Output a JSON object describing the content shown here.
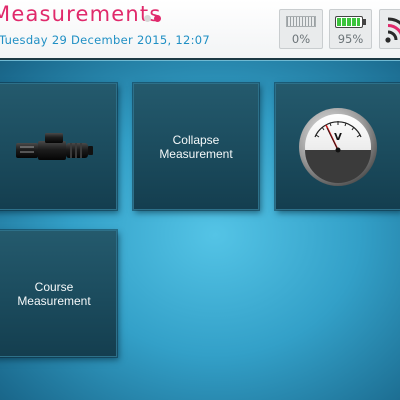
{
  "header": {
    "title": "Measurements",
    "datetime": "Tuesday 29 December 2015, 12:07",
    "page_indicator": {
      "count": 2,
      "active": 2
    },
    "signal": {
      "icon": "signal-strength-icon",
      "value": "0%"
    },
    "battery": {
      "icon": "battery-icon",
      "value": "95%",
      "level": 0.95,
      "color": "#3cc43c"
    },
    "wifi": {
      "icon": "wifi-icon"
    }
  },
  "tiles": [
    {
      "id": "tile-1",
      "icon": "sensor-probe-icon",
      "label": ""
    },
    {
      "id": "tile-2",
      "icon": "",
      "label": "Collapse\nMeasurement"
    },
    {
      "id": "tile-3",
      "icon": "voltmeter-gauge-icon",
      "label": ""
    },
    {
      "id": "tile-4",
      "icon": "",
      "label": "Course\nMeasurement"
    }
  ],
  "colors": {
    "accent": "#e0296b",
    "datetime": "#1f8fc4",
    "background": "#33a0c8",
    "tile": "#1b4b5d"
  }
}
